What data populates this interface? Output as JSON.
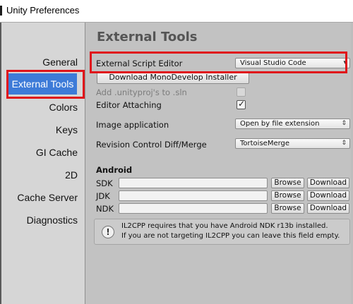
{
  "window": {
    "title": "Unity Preferences"
  },
  "sidebar": {
    "items": [
      {
        "label": "General"
      },
      {
        "label": "External Tools"
      },
      {
        "label": "Colors"
      },
      {
        "label": "Keys"
      },
      {
        "label": "GI Cache"
      },
      {
        "label": "2D"
      },
      {
        "label": "Cache Server"
      },
      {
        "label": "Diagnostics"
      }
    ],
    "selected_index": 1
  },
  "main": {
    "title": "External Tools",
    "script_editor": {
      "label": "External Script Editor",
      "value": "Visual Studio Code"
    },
    "download_button": "Download MonoDevelop Installer",
    "add_unityproj": {
      "label": "Add .unityproj's to .sln",
      "checked": false,
      "enabled": false
    },
    "editor_attaching": {
      "label": "Editor Attaching",
      "checked": true
    },
    "image_application": {
      "label": "Image application",
      "value": "Open by file extension"
    },
    "revision_control": {
      "label": "Revision Control Diff/Merge",
      "value": "TortoiseMerge"
    },
    "android": {
      "heading": "Android",
      "rows": [
        {
          "label": "SDK",
          "value": "",
          "browse": "Browse",
          "download": "Download"
        },
        {
          "label": "JDK",
          "value": "",
          "browse": "Browse",
          "download": "Download"
        },
        {
          "label": "NDK",
          "value": "",
          "browse": "Browse",
          "download": "Download"
        }
      ]
    },
    "help": {
      "line1": "IL2CPP requires that you have Android NDK r13b installed.",
      "line2": "If you are not targeting IL2CPP you can leave this field empty."
    }
  },
  "colors": {
    "highlight": "#e0141a",
    "selection": "#3d7bd8"
  },
  "icons": {
    "info": "info-icon",
    "dropdown": "dropdown-arrow-icon",
    "check": "checkmark-icon"
  }
}
